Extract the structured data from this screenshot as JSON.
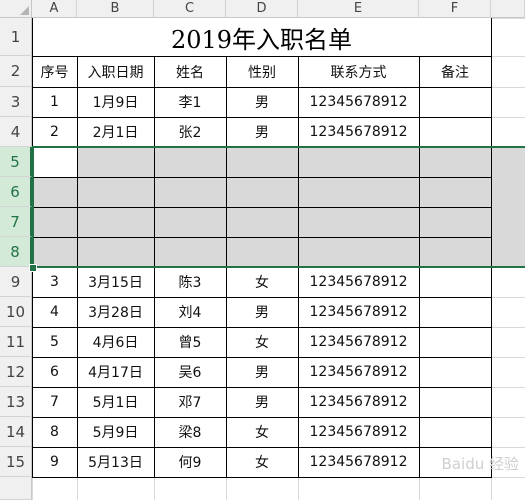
{
  "columns": [
    "A",
    "B",
    "C",
    "D",
    "E",
    "F"
  ],
  "rows": [
    "1",
    "2",
    "3",
    "4",
    "5",
    "6",
    "7",
    "8",
    "9",
    "10",
    "11",
    "12",
    "13",
    "14",
    "15"
  ],
  "title": "2019年入职名单",
  "headers": [
    "序号",
    "入职日期",
    "姓名",
    "性别",
    "联系方式",
    "备注"
  ],
  "data": [
    [
      "1",
      "1月9日",
      "李1",
      "男",
      "12345678912",
      ""
    ],
    [
      "2",
      "2月1日",
      "张2",
      "男",
      "12345678912",
      ""
    ],
    [
      "",
      "",
      "",
      "",
      "",
      ""
    ],
    [
      "",
      "",
      "",
      "",
      "",
      ""
    ],
    [
      "",
      "",
      "",
      "",
      "",
      ""
    ],
    [
      "",
      "",
      "",
      "",
      "",
      ""
    ],
    [
      "3",
      "3月15日",
      "陈3",
      "女",
      "12345678912",
      ""
    ],
    [
      "4",
      "3月28日",
      "刘4",
      "男",
      "12345678912",
      ""
    ],
    [
      "5",
      "4月6日",
      "曾5",
      "女",
      "12345678912",
      ""
    ],
    [
      "6",
      "4月17日",
      "吴6",
      "男",
      "12345678912",
      ""
    ],
    [
      "7",
      "5月1日",
      "邓7",
      "男",
      "12345678912",
      ""
    ],
    [
      "8",
      "5月9日",
      "梁8",
      "女",
      "12345678912",
      ""
    ],
    [
      "9",
      "5月13日",
      "何9",
      "女",
      "12345678912",
      ""
    ]
  ],
  "selection": "5:8",
  "watermark": "Baidu 经验"
}
